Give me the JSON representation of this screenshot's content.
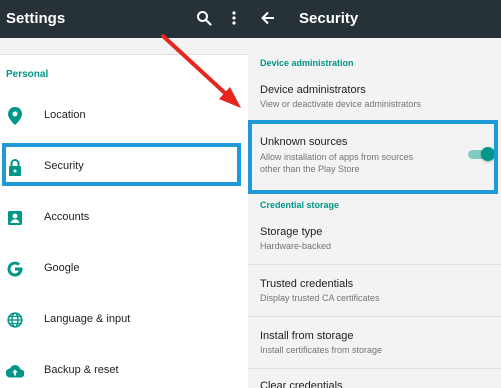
{
  "left_screen": {
    "title": "Settings",
    "section": "Personal",
    "items": [
      {
        "label": "Location",
        "icon": "location-pin-icon"
      },
      {
        "label": "Security",
        "icon": "lock-icon"
      },
      {
        "label": "Accounts",
        "icon": "account-icon"
      },
      {
        "label": "Google",
        "icon": "google-icon"
      },
      {
        "label": "Language & input",
        "icon": "globe-icon"
      },
      {
        "label": "Backup & reset",
        "icon": "cloud-upload-icon"
      }
    ]
  },
  "right_screen": {
    "title": "Security",
    "sections": {
      "device_admin": "Device administration",
      "credential": "Credential storage"
    },
    "items": [
      {
        "title": "Device administrators",
        "subtitle": "View or deactivate device administrators"
      },
      {
        "title": "Unknown sources",
        "subtitle_line1": "Allow installation of apps from sources",
        "subtitle_line2": "other than the Play Store",
        "toggle_on": true
      },
      {
        "title": "Storage type",
        "subtitle": "Hardware-backed"
      },
      {
        "title": "Trusted credentials",
        "subtitle": "Display trusted CA certificates"
      },
      {
        "title": "Install from storage",
        "subtitle": "Install certificates from storage"
      },
      {
        "title": "Clear credentials",
        "subtitle": ""
      }
    ]
  },
  "colors": {
    "appbar": "#263238",
    "accent": "#009688",
    "highlight": "#1f9ad6",
    "arrow": "#e8241e"
  }
}
